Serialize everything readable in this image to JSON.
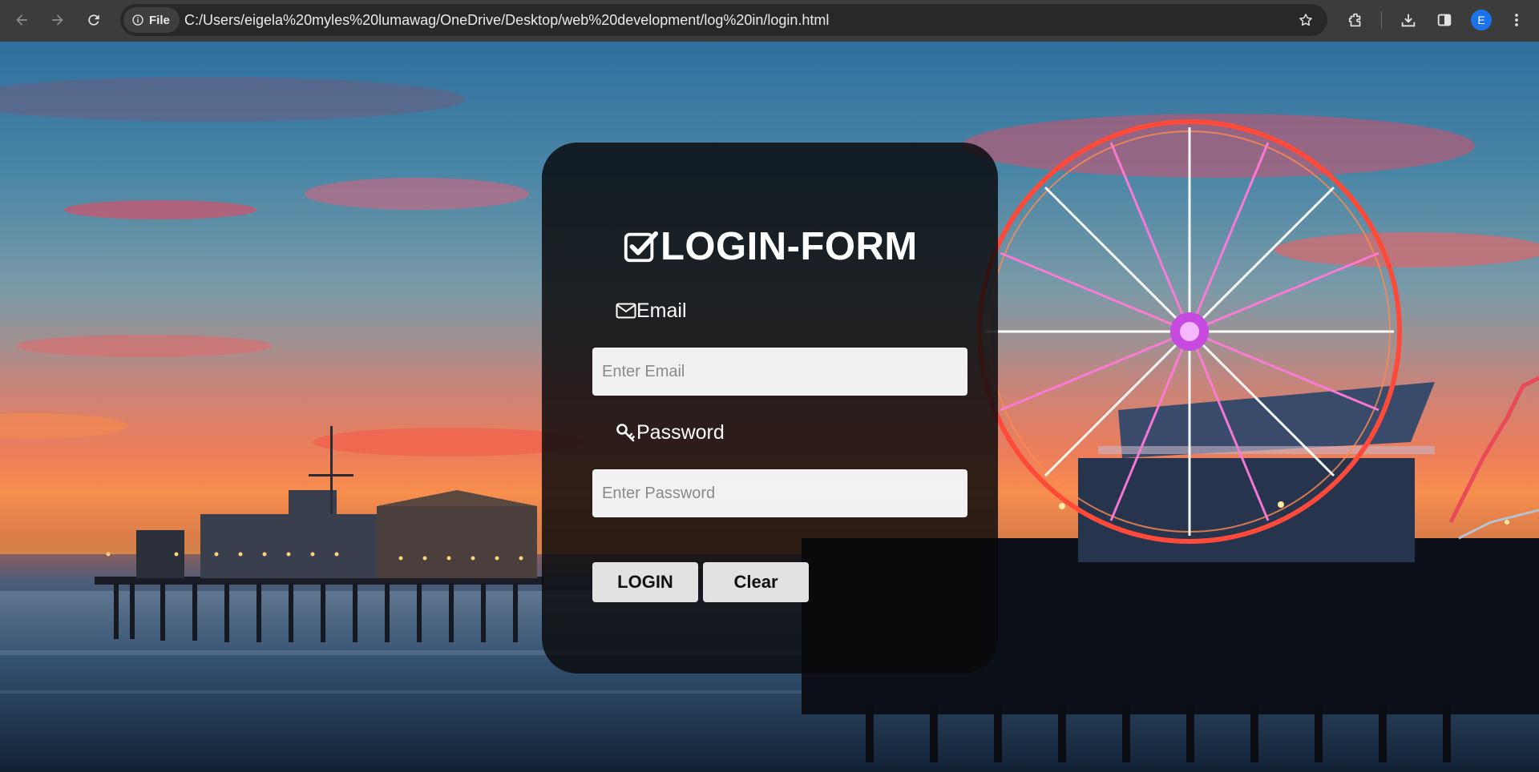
{
  "browser": {
    "site_chip_label": "File",
    "url": "C:/Users/eigela%20myles%20lumawag/OneDrive/Desktop/web%20development/log%20in/login.html",
    "profile_initial": "E",
    "icons": [
      "back-arrow-icon",
      "forward-arrow-icon",
      "reload-icon",
      "info-icon",
      "star-icon",
      "extensions-icon",
      "download-icon",
      "side-panel-icon",
      "more-vert-icon"
    ]
  },
  "login_form": {
    "title": "LOGIN-FORM",
    "email": {
      "label": "Email",
      "placeholder": "Enter Email",
      "value": ""
    },
    "password": {
      "label": "Password",
      "placeholder": "Enter Password",
      "value": ""
    },
    "login_button": "LOGIN",
    "clear_button": "Clear"
  },
  "colors": {
    "chrome_toolbar": "#3c3c3c",
    "omnibox": "#282828",
    "card_background": "rgba(10,10,12,0.84)",
    "button_background": "#e2e2e2",
    "avatar": "#1a73e8"
  }
}
